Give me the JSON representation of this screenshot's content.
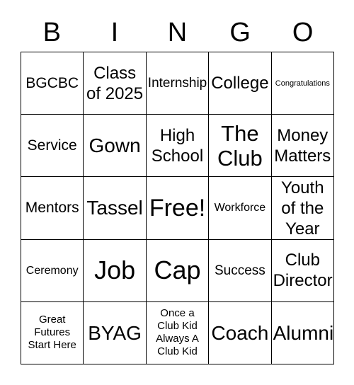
{
  "card": {
    "type": "bingo-card",
    "columns": 5,
    "rows": 5,
    "border_color": "#000000",
    "background_color": "#ffffff",
    "text_color": "#000000"
  },
  "header": {
    "letters": [
      "B",
      "I",
      "N",
      "G",
      "O"
    ]
  },
  "grid": {
    "cells": [
      {
        "text": "BGCBC",
        "size": "ml"
      },
      {
        "text": "Class\nof 2025",
        "size": "l"
      },
      {
        "text": "Internship",
        "size": "m"
      },
      {
        "text": "College",
        "size": "l"
      },
      {
        "text": "Congratulations",
        "size": "xs"
      },
      {
        "text": "Service",
        "size": "ml"
      },
      {
        "text": "Gown",
        "size": "xl"
      },
      {
        "text": "High\nSchool",
        "size": "l"
      },
      {
        "text": "The\nClub",
        "size": "xxl"
      },
      {
        "text": "Money\nMatters",
        "size": "l"
      },
      {
        "text": "Mentors",
        "size": "ml"
      },
      {
        "text": "Tassel",
        "size": "xl"
      },
      {
        "text": "Free!",
        "size": "h1"
      },
      {
        "text": "Workforce",
        "size": "sm"
      },
      {
        "text": "Youth\nof the\nYear",
        "size": "l"
      },
      {
        "text": "Ceremony",
        "size": "sm"
      },
      {
        "text": "Job",
        "size": "h2"
      },
      {
        "text": "Cap",
        "size": "h2"
      },
      {
        "text": "Success",
        "size": "m"
      },
      {
        "text": "Club\nDirector",
        "size": "l"
      },
      {
        "text": "Great\nFutures\nStart Here",
        "size": "s"
      },
      {
        "text": "BYAG",
        "size": "xl"
      },
      {
        "text": "Once a\nClub Kid\nAlways A\nClub Kid",
        "size": "s"
      },
      {
        "text": "Coach",
        "size": "xl"
      },
      {
        "text": "Alumni",
        "size": "xl"
      }
    ]
  }
}
